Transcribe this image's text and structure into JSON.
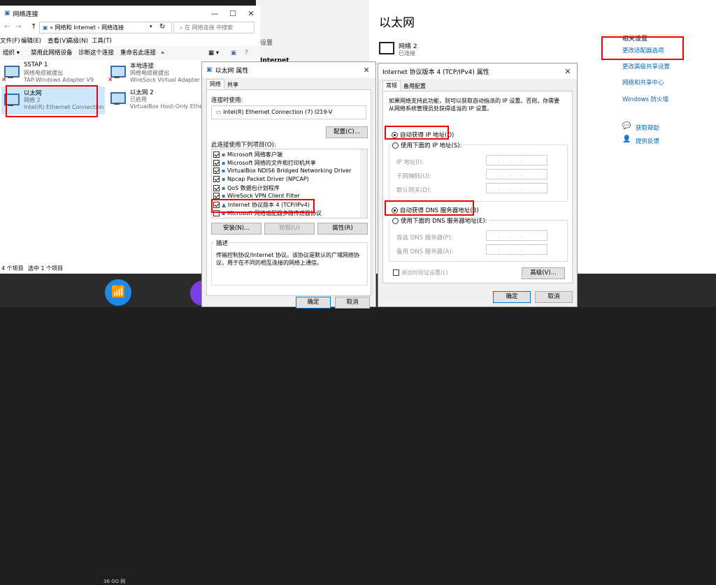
{
  "explorer": {
    "title": "网络连接",
    "breadcrumb": [
      "«",
      "网络和 Internet",
      "›",
      "网络连接"
    ],
    "search_placeholder": "在 网络连接 中搜索",
    "menu": [
      "文件(F)",
      "编辑(E)",
      "查看(V)",
      "高级(N)",
      "工具(T)"
    ],
    "toolbar": [
      "组织 ▾",
      "禁用此网络设备",
      "诊断这个连接",
      "重命名此连接",
      "»"
    ],
    "adapters": [
      {
        "name": "SSTAP 1",
        "status": "网络电缆被拔出",
        "device": "TAP-Windows Adapter V9"
      },
      {
        "name": "本地连接",
        "status": "网络电缆被拔出",
        "device": "WireSock Virtual Adapter"
      },
      {
        "name": "以太网",
        "status": "网络 2",
        "device": "Intel(R) Ethernet Connection (7..."
      },
      {
        "name": "以太网 2",
        "status": "已启用",
        "device": "VirtualBox Host-Only Etherne..."
      }
    ],
    "status_items": "4 个项目",
    "status_selected": "选中 1 个项目"
  },
  "settings": {
    "title": "以太网",
    "network_name": "网络 2",
    "network_status": "已连接",
    "bg_text_1": "设置",
    "bg_text_2": "Internet",
    "related_header": "相关设置",
    "links": [
      "更改适配器选项",
      "更改高级共享设置",
      "网络和共享中心",
      "Windows 防火墙"
    ],
    "help": "获取帮助",
    "feedback": "提供反馈"
  },
  "props": {
    "title": "以太网 属性",
    "tabs": [
      "网络",
      "共享"
    ],
    "connect_using_label": "连接时使用:",
    "adapter": "Intel(R) Ethernet Connection (7) I219-V",
    "configure": "配置(C)...",
    "items_label": "此连接使用下列项目(O):",
    "items": [
      {
        "text": "Microsoft 网络客户端",
        "checked": true
      },
      {
        "text": "Microsoft 网络的文件和打印机共享",
        "checked": true
      },
      {
        "text": "VirtualBox NDIS6 Bridged Networking Driver",
        "checked": true
      },
      {
        "text": "Npcap Packet Driver (NPCAP)",
        "checked": true
      },
      {
        "text": "QoS 数据包计划程序",
        "checked": true
      },
      {
        "text": "WireSock VPN Client Filter",
        "checked": true
      },
      {
        "text": "Internet 协议版本 4 (TCP/IPv4)",
        "checked": true
      },
      {
        "text": "Microsoft 网络适配器多路传送器协议",
        "checked": false
      }
    ],
    "install": "安装(N)...",
    "uninstall": "卸载(U)",
    "properties": "属性(R)",
    "desc_label": "描述",
    "description": "传输控制协议/Internet 协议。该协议是默认的广域网络协议，用于在不同的相互连接的网络上通信。",
    "ok": "确定",
    "cancel": "取消"
  },
  "ipv4": {
    "title": "Internet 协议版本 4 (TCP/IPv4) 属性",
    "tabs": [
      "常规",
      "备用配置"
    ],
    "intro": "如果网络支持此功能，则可以获取自动指派的 IP 设置。否则，你需要从网络系统管理员处获得适当的 IP 设置。",
    "auto_ip": "自动获得 IP 地址(O)",
    "manual_ip": "使用下面的 IP 地址(S):",
    "ip_label": "IP 地址(I):",
    "mask_label": "子网掩码(U):",
    "gw_label": "默认网关(D):",
    "auto_dns": "自动获得 DNS 服务器地址(B)",
    "manual_dns": "使用下面的 DNS 服务器地址(E):",
    "pref_dns": "首选 DNS 服务器(P):",
    "alt_dns": "备用 DNS 服务器(A):",
    "validate": "退出时验证设置(L)",
    "advanced": "高级(V)...",
    "ok": "确定",
    "cancel": "取消",
    "ip_dots": "...",
    "close": "✕"
  },
  "taskbar": {
    "app1": "36 GO 网"
  }
}
